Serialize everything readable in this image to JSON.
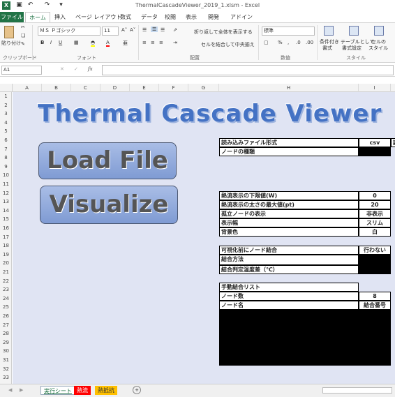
{
  "window": {
    "title": "ThermalCascadeViewer_2019_1.xlsm - Excel"
  },
  "ribbon_tabs": [
    "ファイル",
    "ホーム",
    "挿入",
    "ページ レイアウト",
    "数式",
    "データ",
    "校閲",
    "表示",
    "開発",
    "アドイン"
  ],
  "ribbon": {
    "paste": "貼り付け",
    "clipboard": "クリップボード",
    "font_name": "ＭＳ Ｐゴシック",
    "font_size": "11",
    "font_group": "フォント",
    "wrap": "折り返して全体を表示する",
    "merge": "セルを結合して中央揃え",
    "align_group": "配置",
    "number_format": "標準",
    "number_group": "数値",
    "cond": "条件付き",
    "cond2": "書式",
    "table": "テーブルとして",
    "table2": "書式設定",
    "cellstyle": "セルの",
    "cellstyle2": "スタイル",
    "style_group": "スタイル"
  },
  "formula_bar": {
    "name_box": "A1",
    "fx": "fx"
  },
  "columns": [
    "A",
    "B",
    "C",
    "D",
    "E",
    "F",
    "G",
    "H",
    "I"
  ],
  "rows": [
    "1",
    "2",
    "3",
    "4",
    "5",
    "6",
    "7",
    "8",
    "9",
    "10",
    "11",
    "12",
    "13",
    "14",
    "15",
    "16",
    "17",
    "18",
    "19",
    "20",
    "21",
    "22",
    "23",
    "24",
    "25",
    "26",
    "27",
    "28",
    "29",
    "30",
    "31",
    "32",
    "33"
  ],
  "sheet": {
    "title": "Thermal Cascade Viewer",
    "load_button": "Load File",
    "visualize_button": "Visualize",
    "settings": {
      "file_format_label": "読み込みファイル形式",
      "file_format_value": "csv",
      "file_format_extra": "読",
      "node_type_label": "ノードの種類",
      "lower_limit_label": "熱流表示の下限値(W)",
      "lower_limit_value": "0",
      "max_thickness_label": "熱流表示の太さの最大値(pt)",
      "max_thickness_value": "20",
      "isolated_label": "孤立ノードの表示",
      "isolated_value": "非表示",
      "display_width_label": "表示幅",
      "display_width_value": "スリム",
      "bg_label": "背景色",
      "bg_value": "白",
      "merge_before_label": "可視化前にノード結合",
      "merge_before_value": "行わない",
      "merge_method_label": "結合方法",
      "merge_temp_label": "結合判定温度差（℃）",
      "manual_list_label": "手動結合リスト",
      "node_count_label": "ノード数",
      "node_count_value": "8",
      "node_name_label": "ノード名",
      "merge_no_label": "結合番号"
    }
  },
  "sheet_tabs": [
    "実行シート",
    "熱流",
    "熱抵抗"
  ],
  "colors": {
    "excel_green": "#217346",
    "sheet_bg": "#e0e4f3",
    "title_blue": "#4472c4",
    "tab_red": "#ff0000",
    "tab_orange": "#ffc000"
  }
}
